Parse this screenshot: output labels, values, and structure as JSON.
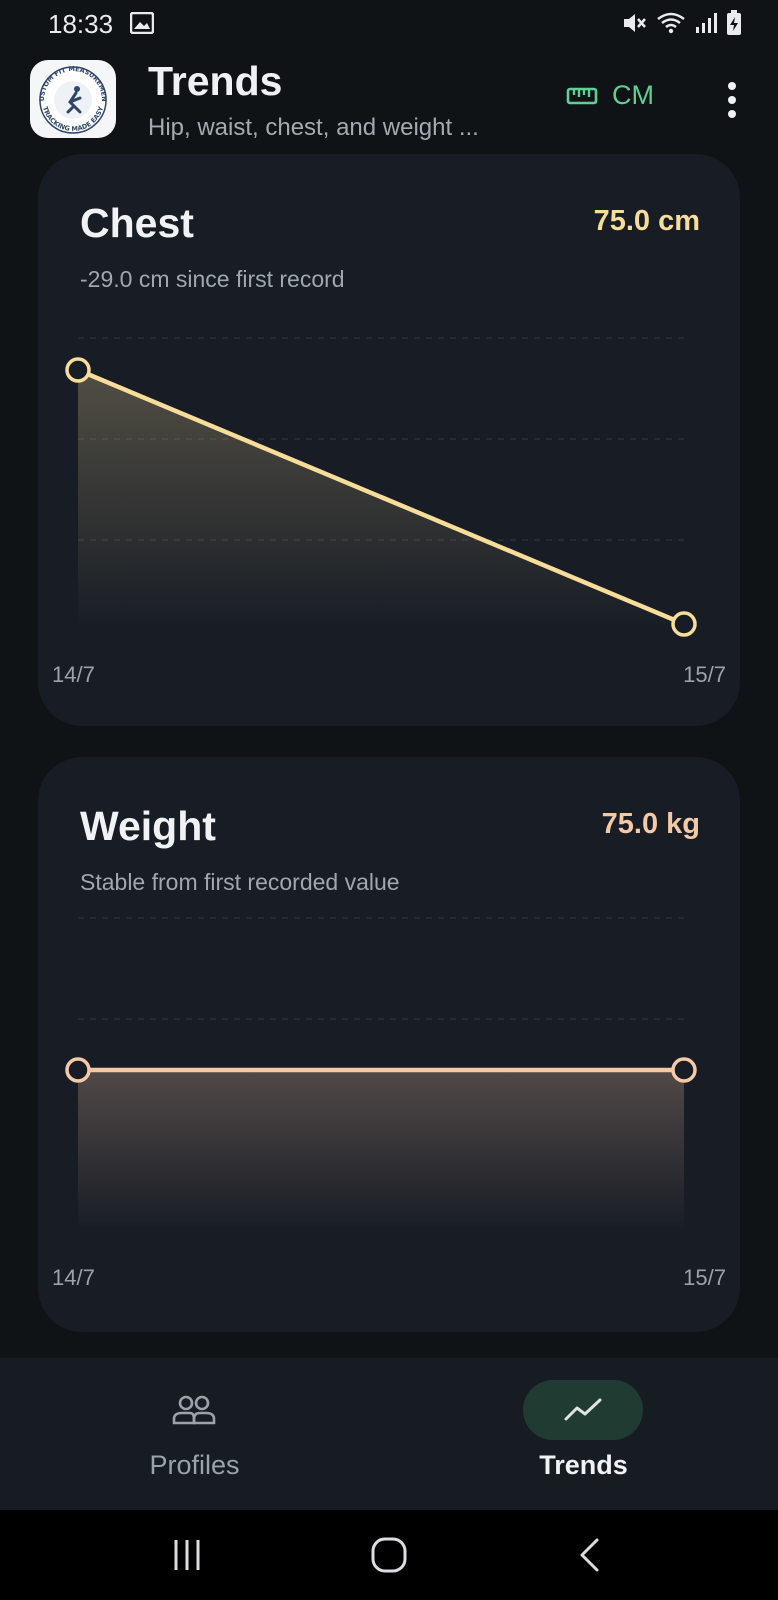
{
  "status_bar": {
    "time": "18:33",
    "icons": [
      "gallery-icon",
      "mute-icon",
      "wifi-icon",
      "signal-icon",
      "battery-charging-icon"
    ]
  },
  "header": {
    "logo_text_top": "CUSTOM FIT MEASUREMENT",
    "logo_text_bottom": "TRACKING MADE EASY",
    "title": "Trends",
    "subtitle": "Hip, waist, chest, and weight ...",
    "unit_icon": "ruler-icon",
    "unit_label": "CM",
    "menu_icon": "more-vert-icon"
  },
  "colors": {
    "chest_accent": "#f7dd99",
    "weight_accent": "#f6c9a6",
    "toggle_accent": "#5fcf94",
    "nav_active_bg": "#1f3b32"
  },
  "cards": [
    {
      "title": "Chest",
      "value": "75.0 cm",
      "note": "-29.0 cm since first record",
      "chart_data": {
        "type": "line",
        "x": [
          "14/7",
          "15/7"
        ],
        "series": [
          {
            "values": [
              104.0,
              75.0
            ]
          }
        ],
        "area_fill": true,
        "grid": true
      }
    },
    {
      "title": "Weight",
      "value": "75.0 kg",
      "note": "Stable from first recorded value",
      "chart_data": {
        "type": "line",
        "x": [
          "14/7",
          "15/7"
        ],
        "series": [
          {
            "values": [
              75.0,
              75.0
            ]
          }
        ],
        "area_fill": true,
        "grid": true
      }
    }
  ],
  "bottom_nav": {
    "items": [
      {
        "label": "Profiles",
        "icon": "people-icon",
        "active": false
      },
      {
        "label": "Trends",
        "icon": "trend-icon",
        "active": true
      }
    ]
  },
  "system_nav": [
    "recents-button",
    "home-button",
    "back-button"
  ]
}
